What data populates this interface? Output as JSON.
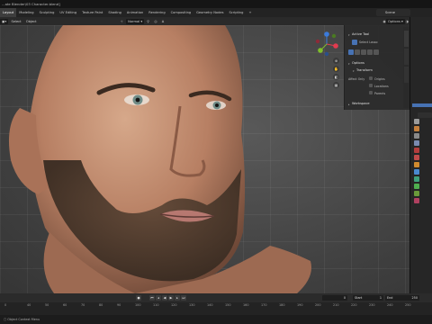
{
  "app": {
    "title": "...ate Blender\\03 Character.blend]"
  },
  "menubar": {
    "workspaces": [
      "Layout",
      "Modeling",
      "Sculpting",
      "UV Editing",
      "Texture Paint",
      "Shading",
      "Animation",
      "Rendering",
      "Compositing",
      "Geometry Nodes",
      "Scripting",
      "+"
    ],
    "active_index": 0,
    "scene_label": "Scene"
  },
  "header": {
    "menus": [
      "Select",
      "Object"
    ],
    "transform_orientation": "Normal",
    "options_label": "Options"
  },
  "npanel": {
    "active_tool_title": "Active Tool",
    "select_tool_label": "Select Lasso",
    "options_title": "Options",
    "transform_title": "Transform",
    "affect_only_label": "Affect Only",
    "affect_options": [
      "Origins",
      "Locations",
      "Parents"
    ],
    "workspace_title": "Workspace"
  },
  "timeline": {
    "frame_start_label": "Start",
    "frame_start": "1",
    "frame_end_label": "End",
    "frame_end": "250",
    "current_frame": "0"
  },
  "ruler": {
    "ticks": [
      "0",
      "40",
      "50",
      "60",
      "70",
      "80",
      "90",
      "100",
      "110",
      "120",
      "130",
      "140",
      "150",
      "160",
      "170",
      "180",
      "190",
      "200",
      "210",
      "220",
      "230",
      "240",
      "250"
    ]
  },
  "status": {
    "text": "Object Context Menu"
  },
  "colors": {
    "accent": "#4772b3",
    "gizmo_x": "#e23b4f",
    "gizmo_y": "#7fbf2a",
    "gizmo_z": "#3b7bdb"
  }
}
